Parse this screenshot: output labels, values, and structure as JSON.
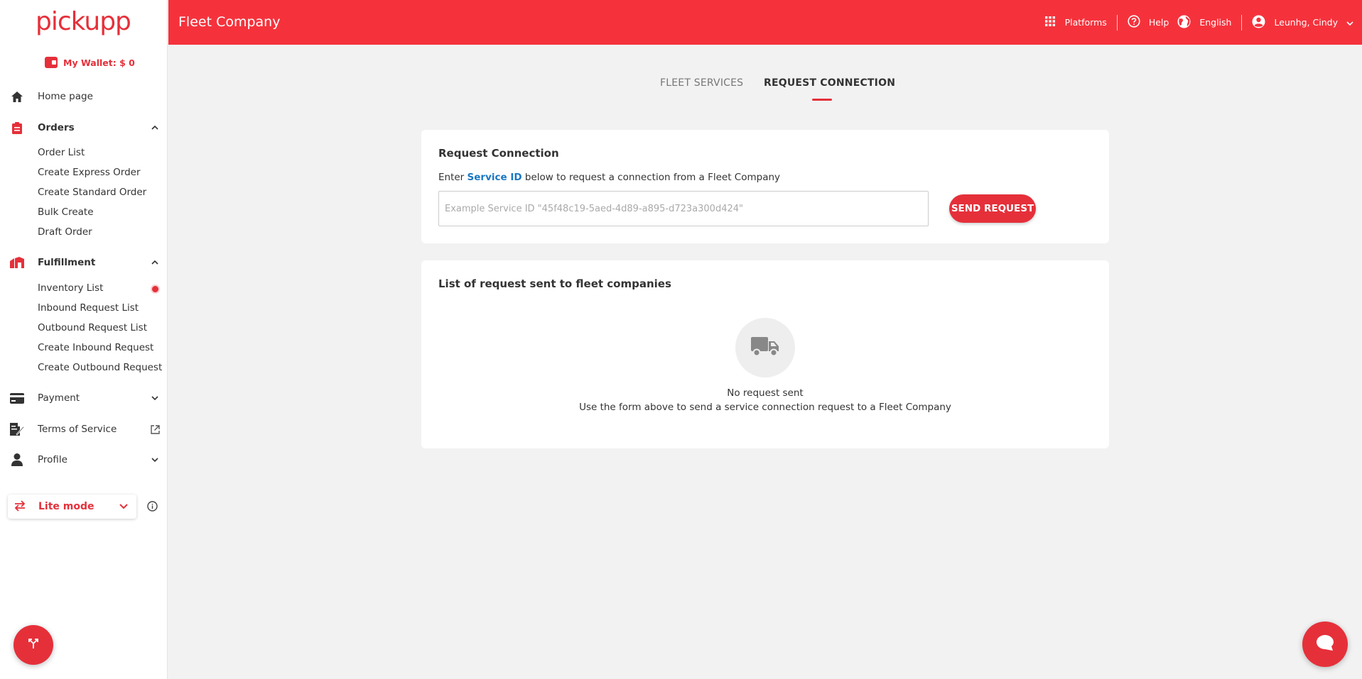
{
  "sidebar": {
    "logo": "pickupp",
    "wallet": "My Wallet: $ 0",
    "home": "Home page",
    "orders": {
      "label": "Orders",
      "items": [
        "Order List",
        "Create Express Order",
        "Create Standard Order",
        "Bulk Create",
        "Draft Order"
      ]
    },
    "fulfillment": {
      "label": "Fulfillment",
      "items": [
        "Inventory List",
        "Inbound Request List",
        "Outbound Request List",
        "Create Inbound Request",
        "Create Outbound Request"
      ]
    },
    "payment": "Payment",
    "terms": "Terms of Service",
    "profile": "Profile",
    "lite_mode": "Lite mode"
  },
  "header": {
    "title": "Fleet Company",
    "platforms": "Platforms",
    "help": "Help",
    "language": "English",
    "user": "Leunhg, Cindy"
  },
  "tabs": {
    "fleet_services": "FLEET SERVICES",
    "request_connection": "REQUEST CONNECTION"
  },
  "request_card": {
    "title": "Request Connection",
    "desc_prefix": "Enter",
    "desc_link": "Service ID",
    "desc_suffix": "below to request a connection from a Fleet Company",
    "input_placeholder": "Example Service ID \"45f48c19-5aed-4d89-a895-d723a300d424\"",
    "input_value": "",
    "button": "SEND REQUEST"
  },
  "list_card": {
    "title": "List of request sent to fleet companies",
    "empty_title": "No request sent",
    "empty_desc": "Use the form above to send a service connection request to a Fleet Company"
  },
  "colors": {
    "brand": "#e5303a",
    "header": "#f5323c",
    "link": "#1a78c2"
  }
}
